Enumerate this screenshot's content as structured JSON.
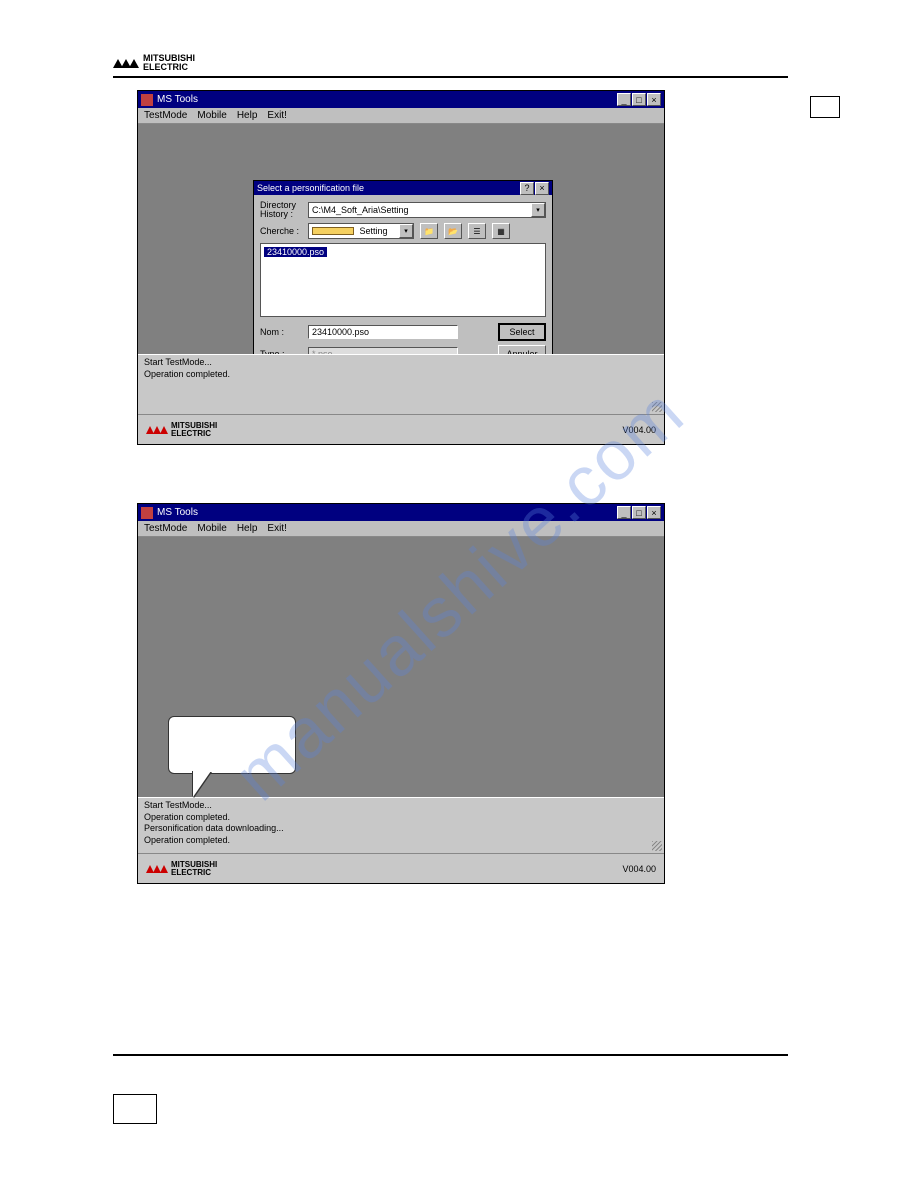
{
  "brand": {
    "line1": "MITSUBISHI",
    "line2": "ELECTRIC"
  },
  "watermark": "manualshive.com",
  "screenshot1": {
    "title": "MS Tools",
    "menu": [
      "TestMode",
      "Mobile",
      "Help",
      "Exit!"
    ],
    "status_lines": [
      "Start TestMode...",
      "Operation completed."
    ],
    "version": "V004.00",
    "dialog": {
      "title": "Select a personification file",
      "labels": {
        "dirhist": "Directory\nHistory :",
        "cherche": "Cherche :",
        "nom": "Nom :",
        "type": "Type :"
      },
      "dirhist_value": "C:\\M4_Soft_Aria\\Setting",
      "cherche_value": "Setting",
      "file_list_item": "23410000.pso",
      "nom_value": "23410000.pso",
      "type_value": "*.pso",
      "buttons": {
        "select": "Select",
        "annuler": "Annuler"
      }
    }
  },
  "screenshot2": {
    "title": "MS Tools",
    "menu": [
      "TestMode",
      "Mobile",
      "Help",
      "Exit!"
    ],
    "status_lines": [
      "Start TestMode...",
      "Operation completed.",
      "Personification data downloading...",
      "Operation completed."
    ],
    "version": "V004.00"
  }
}
